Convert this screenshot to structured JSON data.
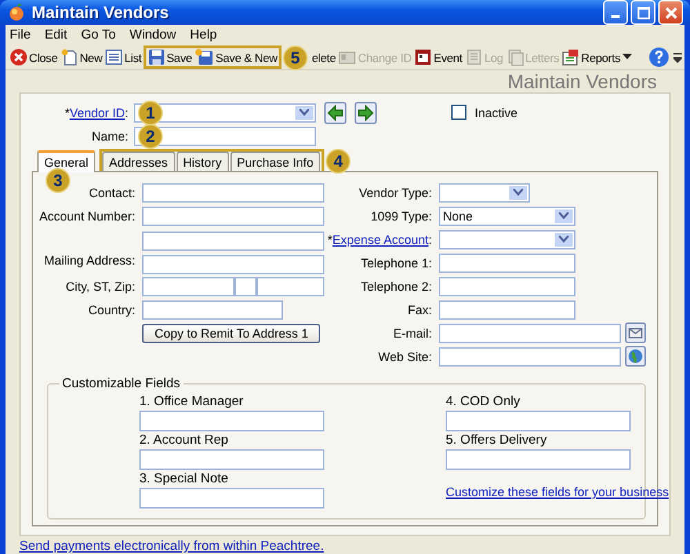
{
  "window": {
    "title": "Maintain Vendors"
  },
  "menu": [
    "File",
    "Edit",
    "Go To",
    "Window",
    "Help"
  ],
  "toolbar": [
    {
      "items": [
        {
          "label": "Close",
          "kind": "button",
          "disabled": false
        },
        {
          "label": "New",
          "kind": "button",
          "disabled": false
        },
        {
          "label": "List",
          "kind": "button",
          "disabled": false
        }
      ]
    },
    {
      "highlighted": true,
      "callout": "5",
      "items": [
        {
          "label": "Save",
          "kind": "button",
          "disabled": false
        },
        {
          "label": "Save & New",
          "kind": "button",
          "disabled": false
        }
      ]
    },
    {
      "items": [
        {
          "label": "elete",
          "kind": "button",
          "disabled": false
        },
        {
          "label": "Change ID",
          "kind": "button",
          "disabled": true
        },
        {
          "label": "Event",
          "kind": "button",
          "disabled": false
        },
        {
          "label": "Log",
          "kind": "button",
          "disabled": true
        },
        {
          "label": "Letters",
          "kind": "button",
          "disabled": true
        },
        {
          "label": "Reports",
          "kind": "dropdown",
          "disabled": false
        }
      ]
    }
  ],
  "heading": "Maintain Vendors",
  "vendor_id": {
    "mark": "*",
    "label": "Vendor ID",
    "colon": ":",
    "callout": "1"
  },
  "name": {
    "label": "Name:",
    "callout": "2"
  },
  "inactive": {
    "label": "Inactive",
    "checked": false
  },
  "tabs": [
    {
      "callout": "3",
      "tabs": [
        {
          "label": "General",
          "selected": true
        }
      ]
    },
    {
      "highlighted": true,
      "callout": "4",
      "tabs": [
        {
          "label": "Addresses",
          "selected": false
        },
        {
          "label": "History",
          "selected": false
        },
        {
          "label": "Purchase Info",
          "selected": false
        }
      ]
    }
  ],
  "left_fields": [
    {
      "kind": "text",
      "label": "Contact:"
    },
    {
      "kind": "text",
      "label": "Account Number:"
    },
    {
      "kind": "address",
      "label": "Mailing Address:"
    },
    {
      "kind": "city",
      "label": "City, ST, Zip:"
    },
    {
      "kind": "short",
      "label": "Country:"
    },
    {
      "kind": "button",
      "label": "Copy to Remit To Address 1"
    }
  ],
  "right_fields": [
    {
      "kind": "select-short",
      "label": "Vendor Type:"
    },
    {
      "kind": "select",
      "label": "1099 Type:",
      "value": "None"
    },
    {
      "kind": "select",
      "mark": "*",
      "label": "Expense Account",
      "colon": ":"
    },
    {
      "kind": "text",
      "label": "Telephone 1:"
    },
    {
      "kind": "text",
      "label": "Telephone 2:"
    },
    {
      "kind": "text",
      "label": "Fax:"
    },
    {
      "kind": "email",
      "label": "E-mail:"
    },
    {
      "kind": "web",
      "label": "Web Site:"
    }
  ],
  "customizable": {
    "title": "Customizable Fields",
    "left": [
      "1. Office Manager",
      "2. Account Rep",
      "3. Special Note"
    ],
    "right": [
      "4. COD Only",
      "5. Offers Delivery"
    ],
    "link": "Customize these fields for your business"
  },
  "footer_link": "Send payments electronically from within Peachtree."
}
